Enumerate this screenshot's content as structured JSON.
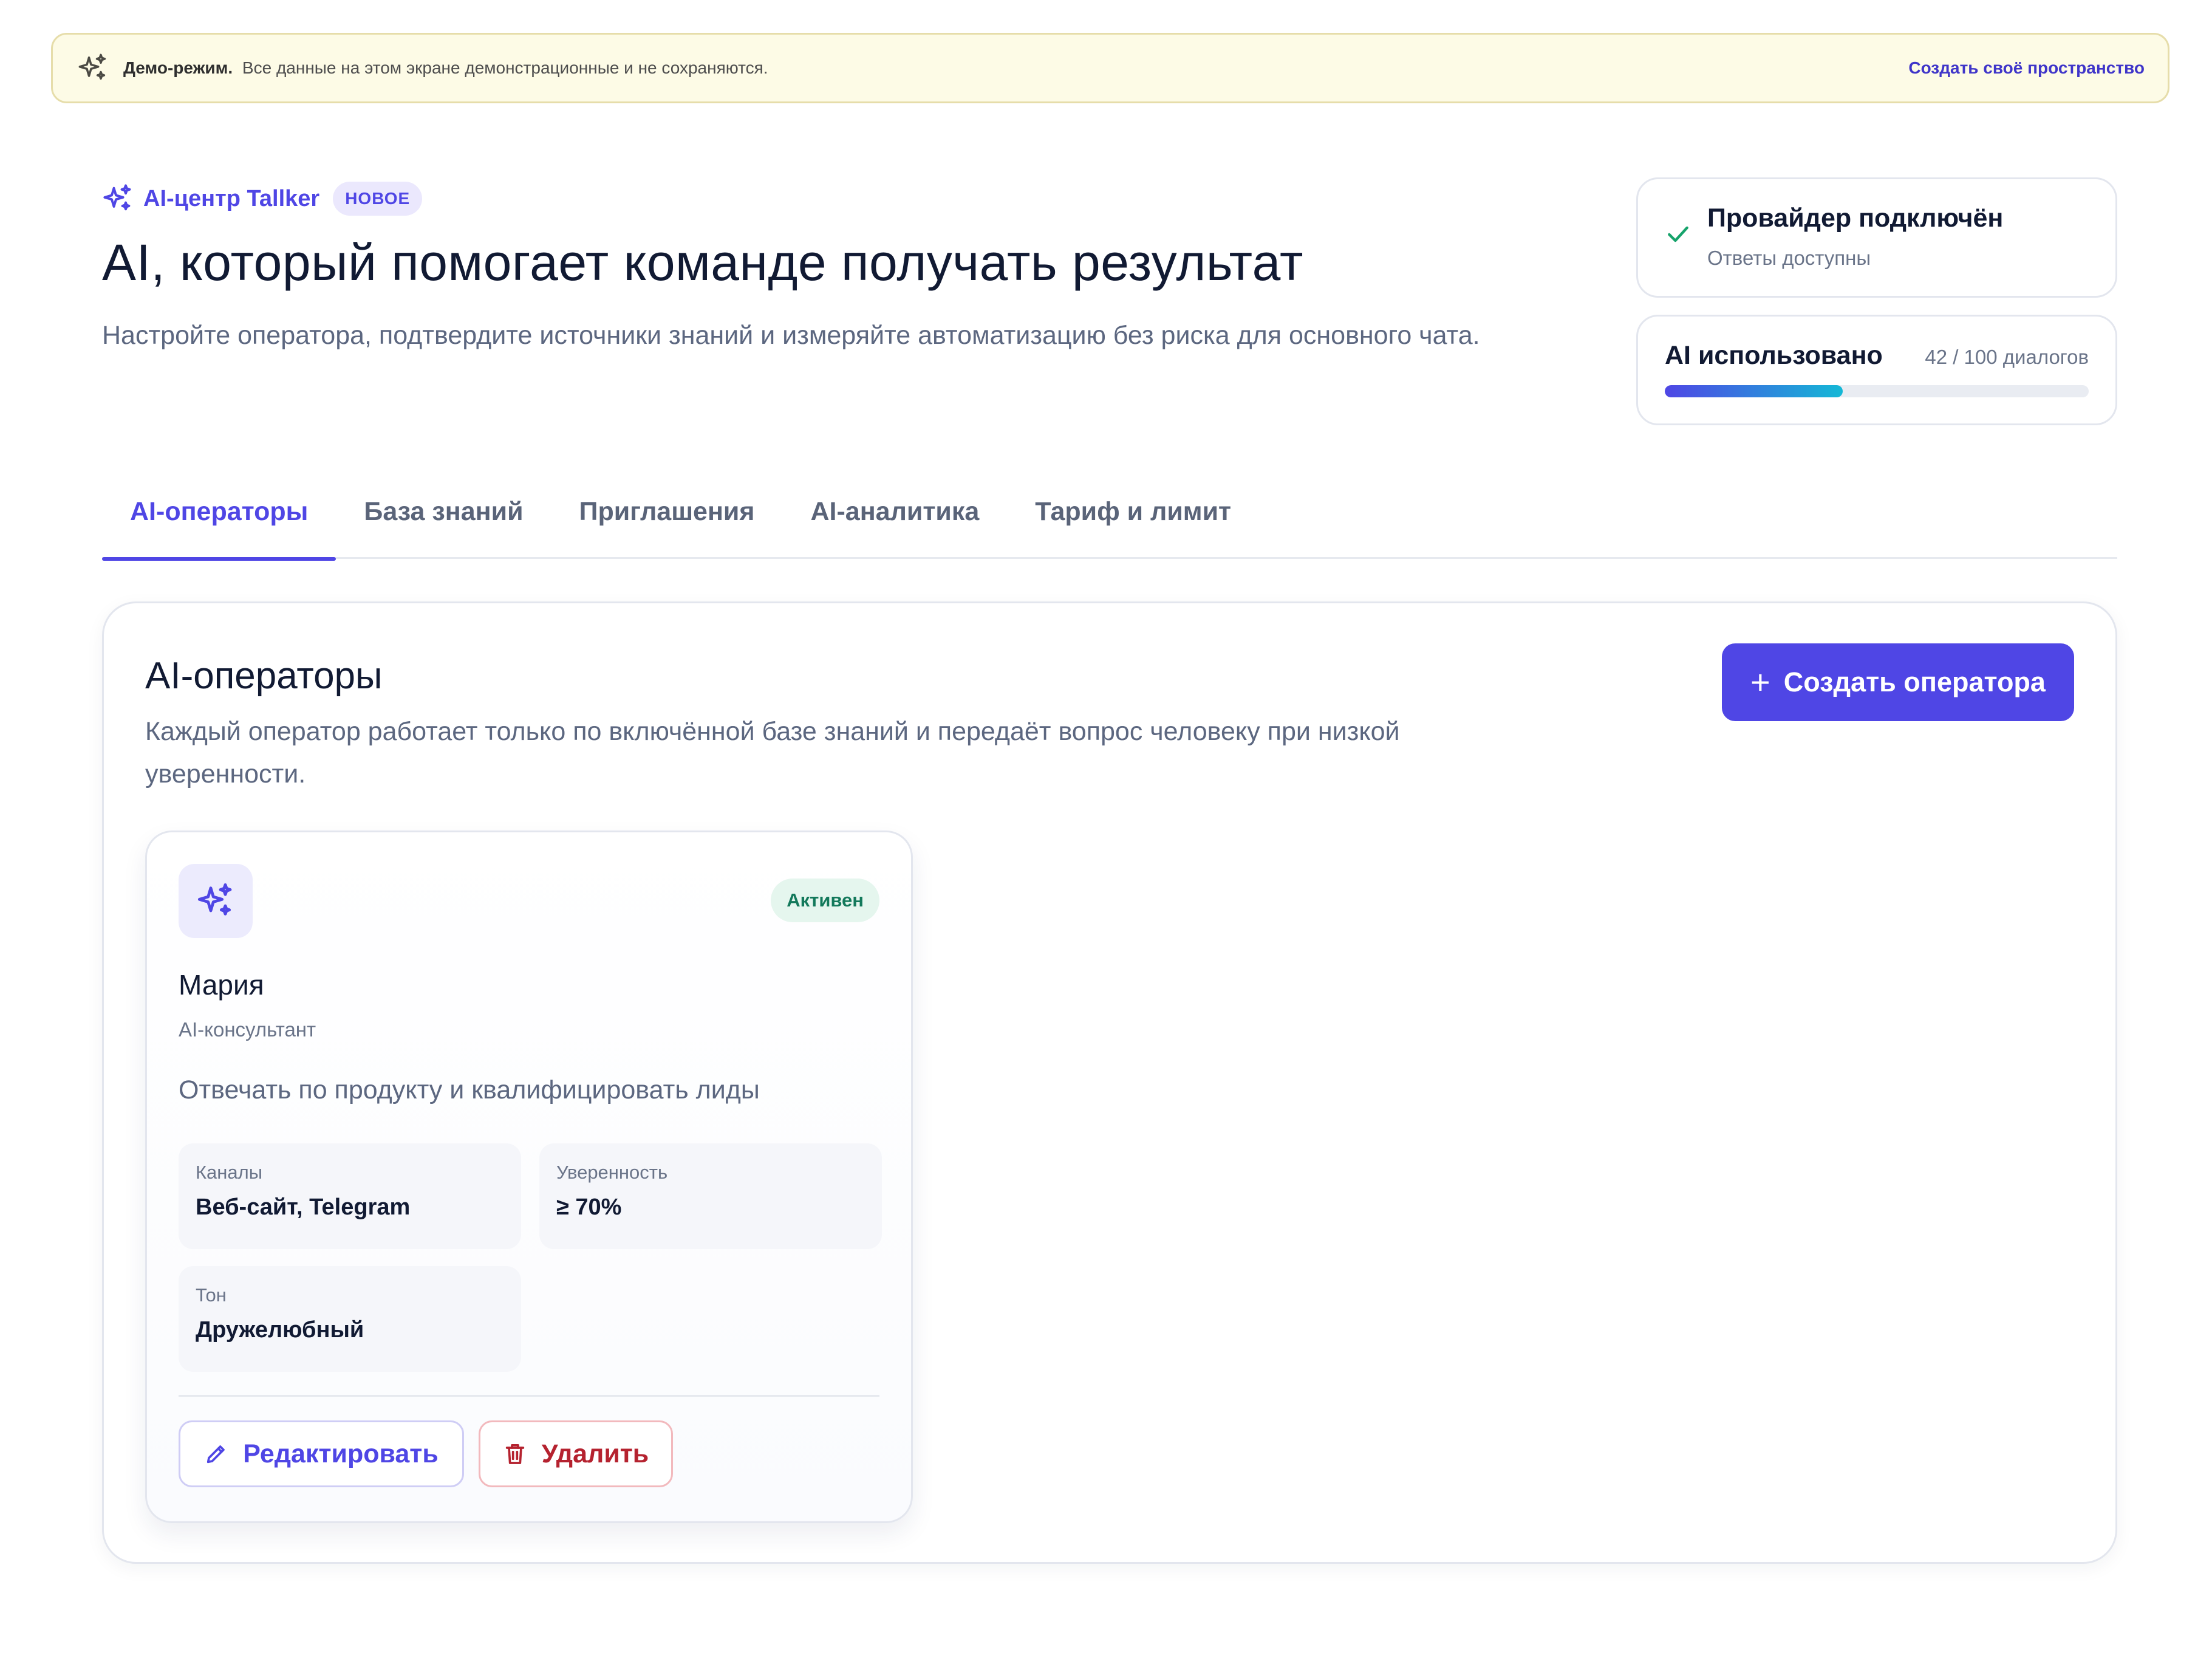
{
  "banner": {
    "icon": "sparkles-icon",
    "title": "Демо-режим.",
    "text": "Все данные на этом экране демонстрационные и не сохраняются.",
    "link": "Создать своё пространство"
  },
  "hero": {
    "tag_icon": "sparkles-icon",
    "tag": "AI-центр Tallker",
    "badge": "НОВОЕ",
    "title": "AI, который помогает команде получать результат",
    "subtitle": "Настройте оператора, подтвердите источники знаний и измеряйте автоматизацию без риска для основного чата."
  },
  "provider": {
    "icon": "check-icon",
    "title": "Провайдер подключён",
    "subtitle": "Ответы доступны",
    "status_color": "#16a36b"
  },
  "usage": {
    "title": "AI использовано",
    "count": "42 / 100 диалогов",
    "used": 42,
    "limit": 100
  },
  "tabs": [
    {
      "label": "AI-операторы",
      "active": true
    },
    {
      "label": "База знаний",
      "active": false
    },
    {
      "label": "Приглашения",
      "active": false
    },
    {
      "label": "AI-аналитика",
      "active": false
    },
    {
      "label": "Тариф и лимит",
      "active": false
    }
  ],
  "panel": {
    "title": "AI-операторы",
    "subtitle": "Каждый оператор работает только по включённой базе знаний и передаёт вопрос человеку при низкой уверенности.",
    "create_icon": "plus-icon",
    "create_label": "Создать оператора"
  },
  "operator": {
    "avatar_icon": "sparkles-icon",
    "status": "Активен",
    "name": "Мария",
    "role": "AI-консультант",
    "goal": "Отвечать по продукту и квалифицировать лиды",
    "fields": [
      {
        "label": "Каналы",
        "value": "Веб-сайт, Telegram"
      },
      {
        "label": "Уверенность",
        "value": "≥ 70%"
      },
      {
        "label": "Тон",
        "value": "Дружелюбный"
      }
    ],
    "edit_icon": "pencil-icon",
    "edit_label": "Редактировать",
    "delete_icon": "trash-icon",
    "delete_label": "Удалить"
  },
  "colors": {
    "accent": "#4f46e5",
    "success": "#16a36b",
    "danger": "#b5222f",
    "banner_bg": "#fdfbe6"
  }
}
